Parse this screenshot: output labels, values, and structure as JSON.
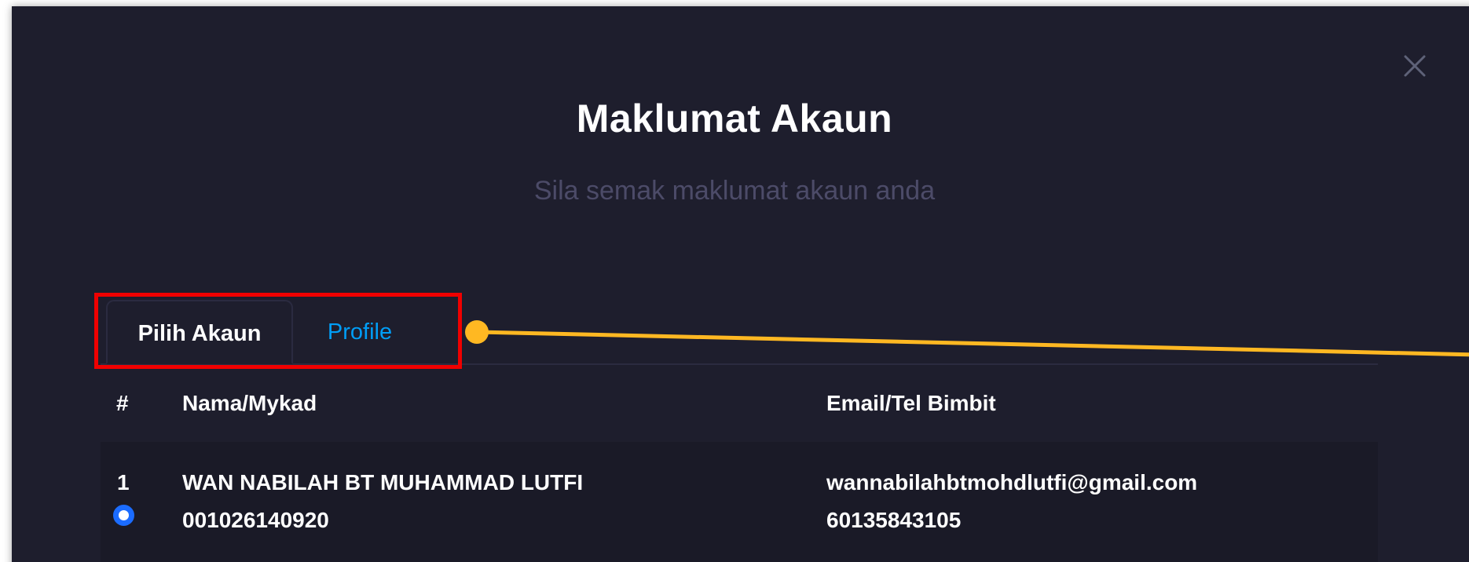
{
  "modal": {
    "title": "Maklumat Akaun",
    "subtitle": "Sila semak maklumat akaun anda",
    "close_icon": "close-icon"
  },
  "tabs": [
    {
      "label": "Pilih Akaun",
      "active": true
    },
    {
      "label": "Profile",
      "active": false
    }
  ],
  "table": {
    "headers": [
      "#",
      "Nama/Mykad",
      "Email/Tel Bimbit"
    ],
    "rows": [
      {
        "index": "1",
        "name": "WAN NABILAH BT MUHAMMAD LUTFI",
        "mykad": "001026140920",
        "email": "wannabilahbtmohdlutfi@gmail.com",
        "phone": "60135843105",
        "selected": true
      }
    ]
  },
  "colors": {
    "background": "#1e1e2d",
    "accent": "#009ef7",
    "highlight": "#f00000",
    "callout": "#ffb822",
    "radio": "#1b6cff"
  }
}
